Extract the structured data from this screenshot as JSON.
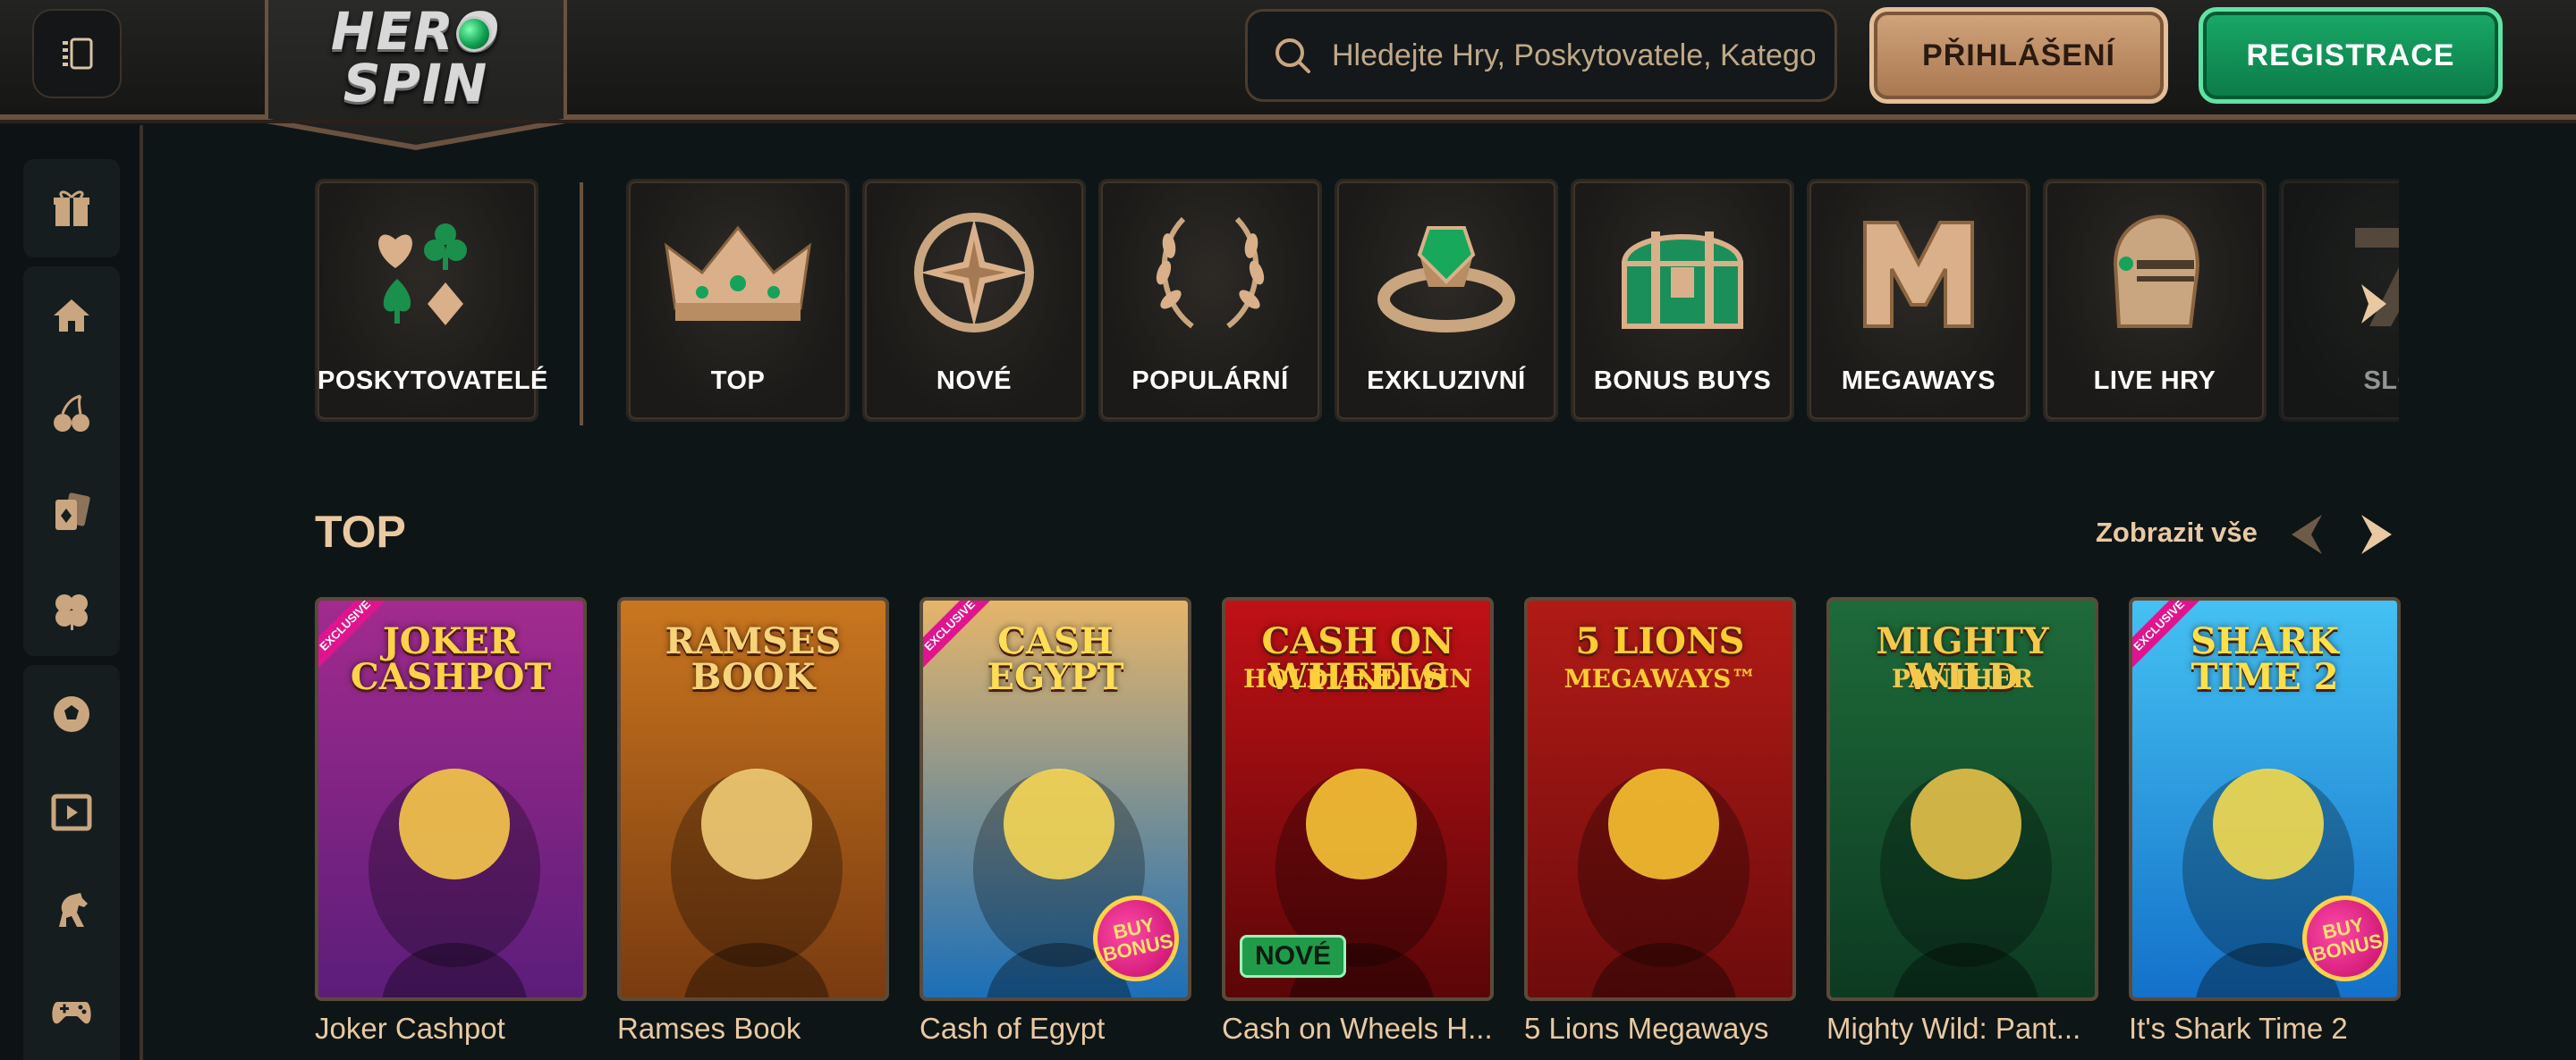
{
  "header": {
    "logo_text": "HERO SPIN",
    "search_placeholder": "Hledejte Hry, Poskytovatele, Katego...",
    "login_label": "PŘIHLÁŠENÍ",
    "register_label": "REGISTRACE"
  },
  "sidebar": {
    "items": [
      {
        "icon": "gift-icon"
      },
      {
        "icon": "home-icon"
      },
      {
        "icon": "cherry-icon"
      },
      {
        "icon": "cards-icon"
      },
      {
        "icon": "clover-icon"
      },
      {
        "icon": "soccer-ball-icon"
      },
      {
        "icon": "live-video-icon"
      },
      {
        "icon": "horse-icon"
      },
      {
        "icon": "gamepad-icon"
      }
    ]
  },
  "categories": {
    "providers": "POSKYTOVATELÉ",
    "items": [
      {
        "label": "TOP",
        "icon": "crown-icon"
      },
      {
        "label": "NOVÉ",
        "icon": "compass-star-icon"
      },
      {
        "label": "POPULÁRNÍ",
        "icon": "laurel-icon"
      },
      {
        "label": "EXKLUZIVNÍ",
        "icon": "ring-icon"
      },
      {
        "label": "BONUS BUYS",
        "icon": "chest-icon"
      },
      {
        "label": "MEGAWAYS",
        "icon": "m-letter-icon"
      },
      {
        "label": "LIVE HRY",
        "icon": "helmet-icon"
      },
      {
        "label": "SLO",
        "icon": "seven-icon"
      }
    ]
  },
  "top_section": {
    "title": "TOP",
    "see_all": "Zobrazit vše",
    "games": [
      {
        "name": "Joker Cashpot",
        "art_title": "JOKER CASHPOT",
        "ribbon": "EXCLUSIVE",
        "bg1": "#5b1d7a",
        "bg2": "#a22b8e",
        "title_color": "#ffd24a"
      },
      {
        "name": "Ramses Book",
        "art_title": "RAMSES BOOK",
        "ribbon": "",
        "bg1": "#7a3b10",
        "bg2": "#c9761f",
        "title_color": "#f7d37a"
      },
      {
        "name": "Cash of Egypt",
        "art_title": "CASH EGYPT",
        "ribbon": "EXCLUSIVE",
        "bg1": "#1b6fb8",
        "bg2": "#e6b56a",
        "title_color": "#ffdd55",
        "bonus": "BUY BONUS"
      },
      {
        "name": "Cash on Wheels H...",
        "art_title": "CASH ON WHEELS",
        "art_sub": "HOLD AND WIN",
        "ribbon": "",
        "bg1": "#5a0608",
        "bg2": "#c01116",
        "title_color": "#ffcf3a",
        "badge": "NOVÉ"
      },
      {
        "name": "5 Lions Megaways",
        "art_title": "5 LIONS",
        "art_sub": "MEGAWAYS™",
        "ribbon": "",
        "bg1": "#6d0c0c",
        "bg2": "#b11b16",
        "title_color": "#ffcc33"
      },
      {
        "name": "Mighty Wild: Pant...",
        "art_title": "MIGHTY WILD",
        "art_sub": "PANTHER",
        "ribbon": "",
        "bg1": "#0d3a22",
        "bg2": "#1e6b3a",
        "title_color": "#f2c94c"
      },
      {
        "name": "It's Shark Time 2",
        "art_title": "SHARK TIME 2",
        "ribbon": "EXCLUSIVE",
        "bg1": "#1371c9",
        "bg2": "#45c1f2",
        "title_color": "#ffe04a",
        "bonus": "BUY BONUS"
      }
    ]
  },
  "colors": {
    "accent_gold": "#e8c9a2",
    "register_green": "#0f8c55",
    "login_tan": "#c4956b"
  }
}
